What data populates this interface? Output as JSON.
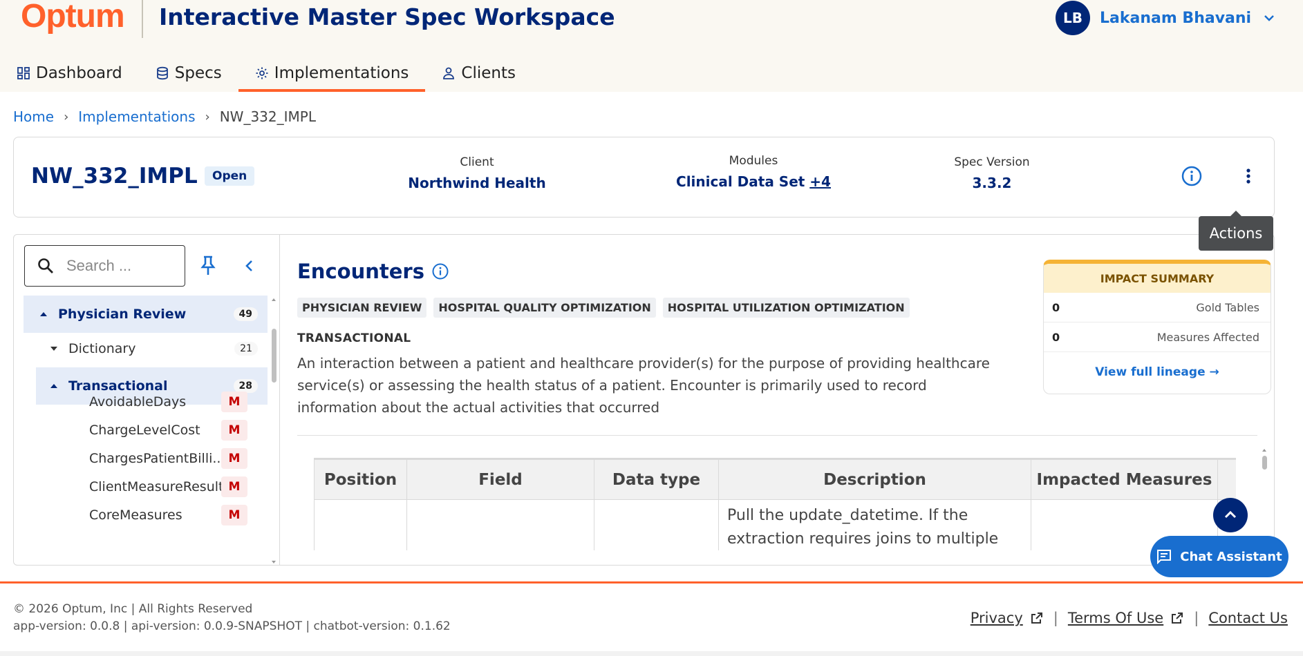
{
  "header": {
    "logo": "Optum",
    "app_title": "Interactive Master Spec Workspace",
    "user": {
      "initials": "LB",
      "name": "Lakanam Bhavani"
    }
  },
  "nav": [
    {
      "label": "Dashboard",
      "icon": "dashboard-icon"
    },
    {
      "label": "Specs",
      "icon": "database-icon"
    },
    {
      "label": "Implementations",
      "icon": "gear-icon",
      "active": true
    },
    {
      "label": "Clients",
      "icon": "person-icon"
    }
  ],
  "breadcrumb": {
    "home": "Home",
    "section": "Implementations",
    "current": "NW_332_IMPL"
  },
  "summary": {
    "name": "NW_332_IMPL",
    "status": "Open",
    "client_label": "Client",
    "client_value": "Northwind Health",
    "modules_label": "Modules",
    "modules_value": "Clinical Data Set",
    "modules_more": "+4",
    "version_label": "Spec Version",
    "version_value": "3.3.2"
  },
  "tooltip": "Actions",
  "sidebar": {
    "search_placeholder": "Search ...",
    "tree": [
      {
        "label": "Physician Review",
        "count": "49"
      },
      {
        "label": "Dictionary",
        "count": "21"
      },
      {
        "label": "Transactional",
        "count": "28"
      }
    ],
    "leaves": [
      {
        "label": "AvoidableDays",
        "badge": "M"
      },
      {
        "label": "ChargeLevelCost",
        "badge": "M"
      },
      {
        "label": "ChargesPatientBilli...",
        "badge": "M"
      },
      {
        "label": "ClientMeasureResult",
        "badge": "M"
      },
      {
        "label": "CoreMeasures",
        "badge": "M"
      }
    ]
  },
  "entity": {
    "title": "Encounters",
    "tags": [
      "PHYSICIAN REVIEW",
      "HOSPITAL QUALITY OPTIMIZATION",
      "HOSPITAL UTILIZATION OPTIMIZATION"
    ],
    "type": "TRANSACTIONAL",
    "description": "An interaction between a patient and healthcare provider(s) for the purpose of providing healthcare service(s) or assessing the health status of a patient. Encounter is primarily used to record information about the actual activities that occurred"
  },
  "impact": {
    "title": "IMPACT SUMMARY",
    "gold_tables": "0",
    "gold_tables_label": "Gold Tables",
    "measures": "0",
    "measures_label": "Measures Affected",
    "link": "View full lineage →"
  },
  "table": {
    "columns": [
      "Position",
      "Field",
      "Data type",
      "Description",
      "Impacted Measures"
    ],
    "rows": [
      {
        "position": "",
        "field": "",
        "data_type": "",
        "description": "Pull the update_datetime.  If the extraction requires joins to multiple",
        "impacted": ""
      }
    ]
  },
  "chat_label": "Chat Assistant",
  "footer": {
    "copyright": "© 2026 Optum, Inc | All Rights Reserved",
    "versions": "app-version: 0.0.8 | api-version: 0.0.9-SNAPSHOT | chatbot-version: 0.1.62",
    "privacy": "Privacy",
    "terms": "Terms Of Use",
    "contact": "Contact Us"
  },
  "colors": {
    "brand": "#ff612b",
    "navy": "#002677",
    "link": "#196ecf",
    "badge": "#c40000"
  }
}
